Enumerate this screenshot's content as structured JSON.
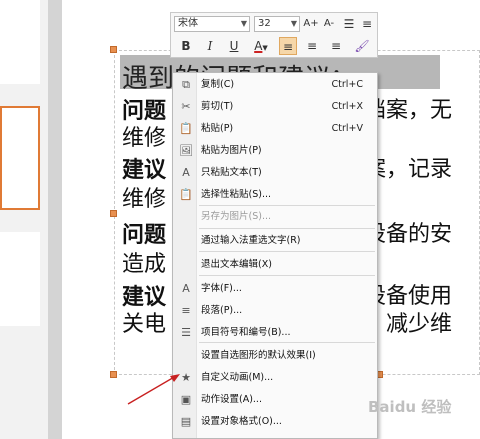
{
  "toolbar": {
    "font_name": "宋体",
    "font_size": "32",
    "grow_label": "A+",
    "shrink_label": "A-",
    "bold_label": "B",
    "italic_label": "I",
    "underline_label": "U",
    "font_color_label": "A",
    "accent": "#cc2222"
  },
  "slide": {
    "heading": "遇到的问题和建议：",
    "lines": [
      {
        "left": "问题",
        "right": "修档案，无"
      },
      {
        "left": "维修",
        "right": ""
      },
      {
        "left": "建议",
        "right": "档案，记录"
      },
      {
        "left": "维修",
        "right": ""
      },
      {
        "left": "问题",
        "right": "对设备的安"
      },
      {
        "left": "造成",
        "right": ""
      },
      {
        "left": "建议",
        "right": "本设备使用"
      },
      {
        "left": "关电",
        "right": "，减少维"
      }
    ]
  },
  "menu": {
    "items": [
      {
        "label": "复制(C)",
        "shortcut": "Ctrl+C",
        "icon": "copy-icon",
        "glyph": "⧉",
        "disabled": false
      },
      {
        "label": "剪切(T)",
        "shortcut": "Ctrl+X",
        "icon": "cut-icon",
        "glyph": "✂",
        "disabled": false
      },
      {
        "label": "粘贴(P)",
        "shortcut": "Ctrl+V",
        "icon": "paste-icon",
        "glyph": "📋",
        "disabled": false
      },
      {
        "label": "粘贴为图片(P)",
        "shortcut": "",
        "icon": "paste-image-icon",
        "glyph": "🖼",
        "disabled": false
      },
      {
        "label": "只粘贴文本(T)",
        "shortcut": "",
        "icon": "paste-text-icon",
        "glyph": "A",
        "disabled": false
      },
      {
        "label": "选择性粘贴(S)...",
        "shortcut": "",
        "icon": "paste-special-icon",
        "glyph": "📋",
        "disabled": false
      },
      {
        "label": "另存为图片(S)...",
        "shortcut": "",
        "icon": "",
        "glyph": "",
        "disabled": true
      },
      {
        "label": "通过输入法重选文字(R)",
        "shortcut": "",
        "icon": "",
        "glyph": "",
        "disabled": false
      },
      {
        "label": "退出文本编辑(X)",
        "shortcut": "",
        "icon": "",
        "glyph": "",
        "disabled": false
      },
      {
        "label": "字体(F)...",
        "shortcut": "",
        "icon": "font-icon",
        "glyph": "A",
        "disabled": false
      },
      {
        "label": "段落(P)...",
        "shortcut": "",
        "icon": "paragraph-icon",
        "glyph": "≡",
        "disabled": false
      },
      {
        "label": "项目符号和编号(B)...",
        "shortcut": "",
        "icon": "bullets-icon",
        "glyph": "☰",
        "disabled": false
      },
      {
        "label": "设置自选图形的默认效果(I)",
        "shortcut": "",
        "icon": "",
        "glyph": "",
        "disabled": false
      },
      {
        "label": "自定义动画(M)...",
        "shortcut": "",
        "icon": "custom-animation-icon",
        "glyph": "★",
        "disabled": false
      },
      {
        "label": "动作设置(A)...",
        "shortcut": "",
        "icon": "action-settings-icon",
        "glyph": "▣",
        "disabled": false
      },
      {
        "label": "设置对象格式(O)...",
        "shortcut": "",
        "icon": "format-object-icon",
        "glyph": "▤",
        "disabled": false
      }
    ]
  },
  "watermark": "Baidu 经验"
}
